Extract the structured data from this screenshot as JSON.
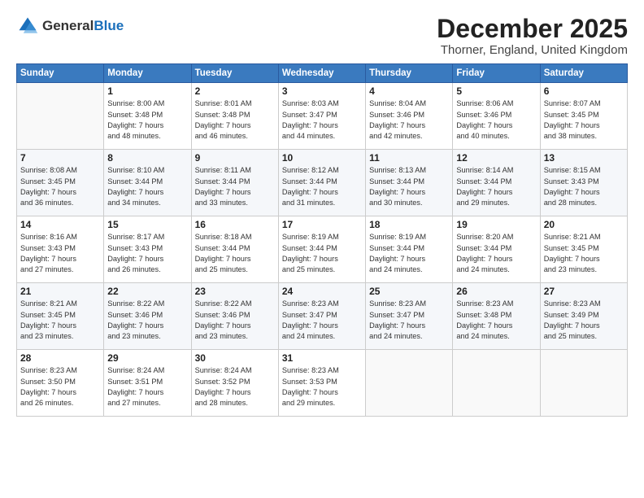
{
  "logo": {
    "general": "General",
    "blue": "Blue"
  },
  "header": {
    "month": "December 2025",
    "location": "Thorner, England, United Kingdom"
  },
  "columns": [
    "Sunday",
    "Monday",
    "Tuesday",
    "Wednesday",
    "Thursday",
    "Friday",
    "Saturday"
  ],
  "weeks": [
    [
      {
        "day": "",
        "info": ""
      },
      {
        "day": "1",
        "info": "Sunrise: 8:00 AM\nSunset: 3:48 PM\nDaylight: 7 hours\nand 48 minutes."
      },
      {
        "day": "2",
        "info": "Sunrise: 8:01 AM\nSunset: 3:48 PM\nDaylight: 7 hours\nand 46 minutes."
      },
      {
        "day": "3",
        "info": "Sunrise: 8:03 AM\nSunset: 3:47 PM\nDaylight: 7 hours\nand 44 minutes."
      },
      {
        "day": "4",
        "info": "Sunrise: 8:04 AM\nSunset: 3:46 PM\nDaylight: 7 hours\nand 42 minutes."
      },
      {
        "day": "5",
        "info": "Sunrise: 8:06 AM\nSunset: 3:46 PM\nDaylight: 7 hours\nand 40 minutes."
      },
      {
        "day": "6",
        "info": "Sunrise: 8:07 AM\nSunset: 3:45 PM\nDaylight: 7 hours\nand 38 minutes."
      }
    ],
    [
      {
        "day": "7",
        "info": "Sunrise: 8:08 AM\nSunset: 3:45 PM\nDaylight: 7 hours\nand 36 minutes."
      },
      {
        "day": "8",
        "info": "Sunrise: 8:10 AM\nSunset: 3:44 PM\nDaylight: 7 hours\nand 34 minutes."
      },
      {
        "day": "9",
        "info": "Sunrise: 8:11 AM\nSunset: 3:44 PM\nDaylight: 7 hours\nand 33 minutes."
      },
      {
        "day": "10",
        "info": "Sunrise: 8:12 AM\nSunset: 3:44 PM\nDaylight: 7 hours\nand 31 minutes."
      },
      {
        "day": "11",
        "info": "Sunrise: 8:13 AM\nSunset: 3:44 PM\nDaylight: 7 hours\nand 30 minutes."
      },
      {
        "day": "12",
        "info": "Sunrise: 8:14 AM\nSunset: 3:44 PM\nDaylight: 7 hours\nand 29 minutes."
      },
      {
        "day": "13",
        "info": "Sunrise: 8:15 AM\nSunset: 3:43 PM\nDaylight: 7 hours\nand 28 minutes."
      }
    ],
    [
      {
        "day": "14",
        "info": "Sunrise: 8:16 AM\nSunset: 3:43 PM\nDaylight: 7 hours\nand 27 minutes."
      },
      {
        "day": "15",
        "info": "Sunrise: 8:17 AM\nSunset: 3:43 PM\nDaylight: 7 hours\nand 26 minutes."
      },
      {
        "day": "16",
        "info": "Sunrise: 8:18 AM\nSunset: 3:44 PM\nDaylight: 7 hours\nand 25 minutes."
      },
      {
        "day": "17",
        "info": "Sunrise: 8:19 AM\nSunset: 3:44 PM\nDaylight: 7 hours\nand 25 minutes."
      },
      {
        "day": "18",
        "info": "Sunrise: 8:19 AM\nSunset: 3:44 PM\nDaylight: 7 hours\nand 24 minutes."
      },
      {
        "day": "19",
        "info": "Sunrise: 8:20 AM\nSunset: 3:44 PM\nDaylight: 7 hours\nand 24 minutes."
      },
      {
        "day": "20",
        "info": "Sunrise: 8:21 AM\nSunset: 3:45 PM\nDaylight: 7 hours\nand 23 minutes."
      }
    ],
    [
      {
        "day": "21",
        "info": "Sunrise: 8:21 AM\nSunset: 3:45 PM\nDaylight: 7 hours\nand 23 minutes."
      },
      {
        "day": "22",
        "info": "Sunrise: 8:22 AM\nSunset: 3:46 PM\nDaylight: 7 hours\nand 23 minutes."
      },
      {
        "day": "23",
        "info": "Sunrise: 8:22 AM\nSunset: 3:46 PM\nDaylight: 7 hours\nand 23 minutes."
      },
      {
        "day": "24",
        "info": "Sunrise: 8:23 AM\nSunset: 3:47 PM\nDaylight: 7 hours\nand 24 minutes."
      },
      {
        "day": "25",
        "info": "Sunrise: 8:23 AM\nSunset: 3:47 PM\nDaylight: 7 hours\nand 24 minutes."
      },
      {
        "day": "26",
        "info": "Sunrise: 8:23 AM\nSunset: 3:48 PM\nDaylight: 7 hours\nand 24 minutes."
      },
      {
        "day": "27",
        "info": "Sunrise: 8:23 AM\nSunset: 3:49 PM\nDaylight: 7 hours\nand 25 minutes."
      }
    ],
    [
      {
        "day": "28",
        "info": "Sunrise: 8:23 AM\nSunset: 3:50 PM\nDaylight: 7 hours\nand 26 minutes."
      },
      {
        "day": "29",
        "info": "Sunrise: 8:24 AM\nSunset: 3:51 PM\nDaylight: 7 hours\nand 27 minutes."
      },
      {
        "day": "30",
        "info": "Sunrise: 8:24 AM\nSunset: 3:52 PM\nDaylight: 7 hours\nand 28 minutes."
      },
      {
        "day": "31",
        "info": "Sunrise: 8:23 AM\nSunset: 3:53 PM\nDaylight: 7 hours\nand 29 minutes."
      },
      {
        "day": "",
        "info": ""
      },
      {
        "day": "",
        "info": ""
      },
      {
        "day": "",
        "info": ""
      }
    ]
  ]
}
